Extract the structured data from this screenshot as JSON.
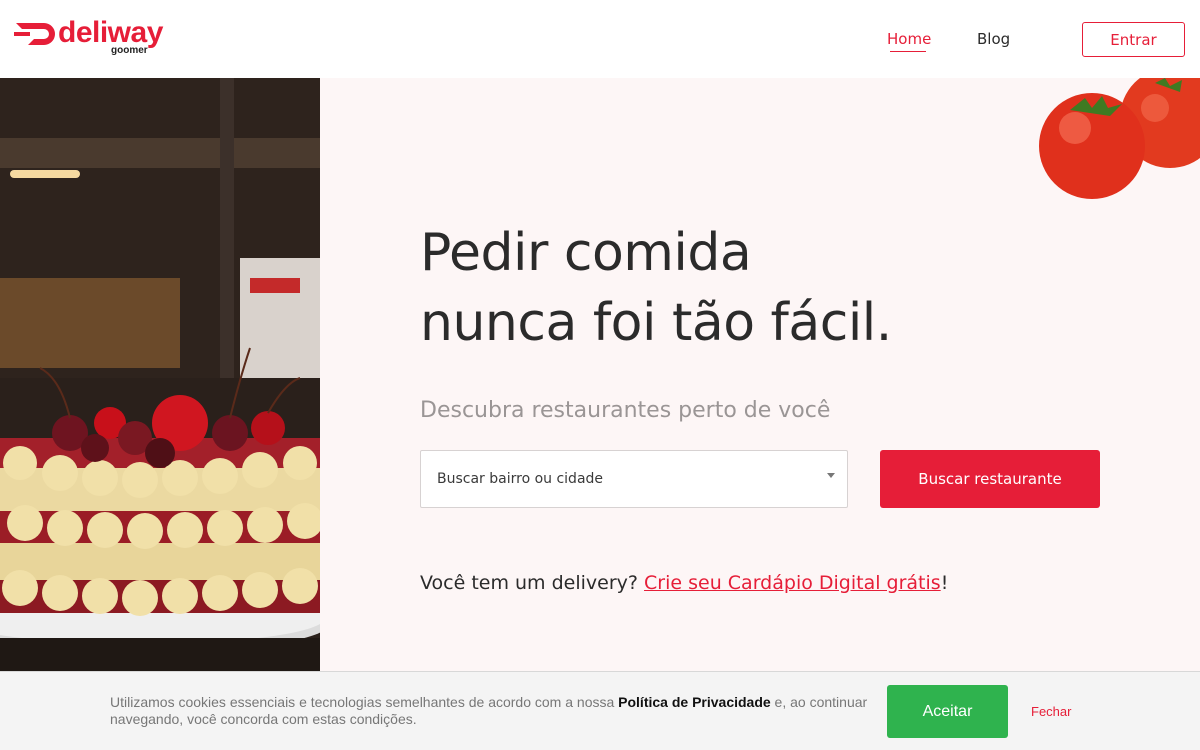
{
  "brand": {
    "name": "deliway",
    "sub": "goomer",
    "color": "#e61e38"
  },
  "nav": {
    "home": "Home",
    "blog": "Blog",
    "login": "Entrar"
  },
  "hero": {
    "headline_line1": "Pedir comida",
    "headline_line2": "nunca foi tão fácil.",
    "subhead": "Descubra restaurantes perto de você"
  },
  "search": {
    "select_value": "Buscar bairro ou cidade",
    "button": "Buscar restaurante"
  },
  "delivery": {
    "prefix": "Você tem um delivery? ",
    "link": "Crie seu Cardápio Digital grátis",
    "suffix": "!"
  },
  "cookie": {
    "text_before": "Utilizamos cookies essenciais e tecnologias semelhantes de acordo com a nossa ",
    "policy": "Política de Privacidade",
    "text_after": " e, ao continuar navegando, você concorda com estas condições.",
    "accept": "Aceitar",
    "close": "Fechar"
  },
  "colors": {
    "accent": "#e61e38",
    "accept": "#2fb34e",
    "background": "#fdf6f6"
  }
}
